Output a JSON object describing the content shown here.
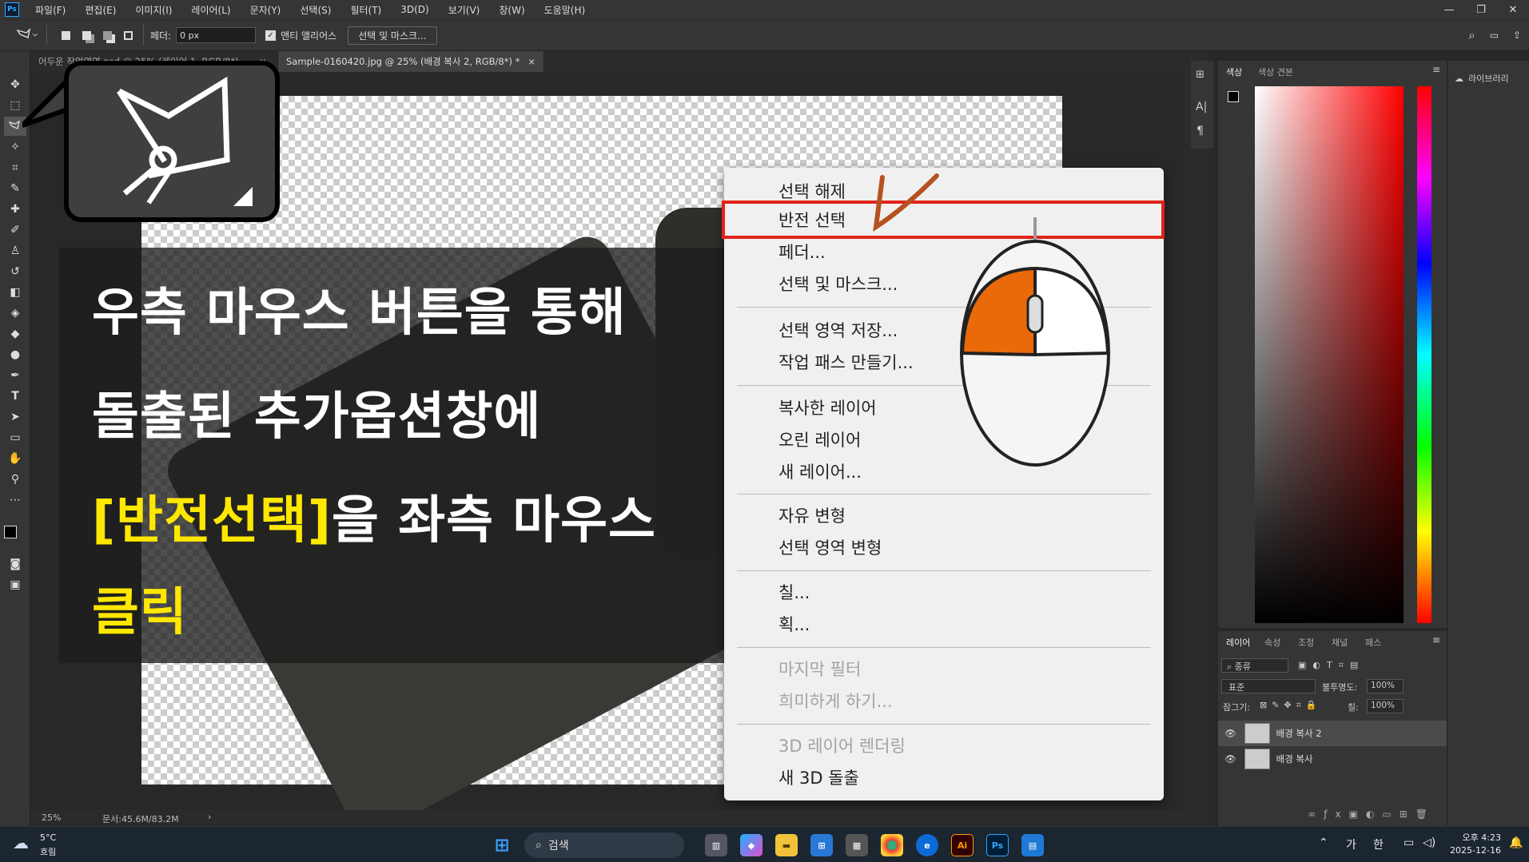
{
  "menubar": {
    "logo": "Ps",
    "items": [
      "파일(F)",
      "편집(E)",
      "이미지(I)",
      "레이어(L)",
      "문자(Y)",
      "선택(S)",
      "필터(T)",
      "3D(D)",
      "보기(V)",
      "창(W)",
      "도움말(H)"
    ]
  },
  "options": {
    "feather_label": "페더:",
    "feather_value": "0 px",
    "antialias_label": "앤티 앨리어스",
    "select_mask_button": "선택 및 마스크..."
  },
  "tabs": [
    {
      "label": "어두운 작업영역.psd @ 25% (레이어 1, RGB/8*)",
      "active": false
    },
    {
      "label": "Sample-0160420.jpg @ 25% (배경 복사 2, RGB/8*) *",
      "active": true
    }
  ],
  "overlay_text": {
    "line1": "우측 마우스 버튼을 통해",
    "line2": "돌출된 추가옵션창에",
    "line3_highlight": "[반전선택]",
    "line3_rest": "을 좌측 마우스",
    "line4": "클릭"
  },
  "context_menu": {
    "items": [
      {
        "label": "선택 해제",
        "enabled": true
      },
      {
        "label": "반전 선택",
        "enabled": true,
        "highlighted": true
      },
      {
        "label": "페더...",
        "enabled": true
      },
      {
        "label": "선택 및 마스크...",
        "enabled": true
      },
      {
        "label": "선택 영역 저장...",
        "enabled": true
      },
      {
        "label": "작업 패스 만들기...",
        "enabled": true
      },
      {
        "label": "복사한 레이어",
        "enabled": true
      },
      {
        "label": "오린 레이어",
        "enabled": true
      },
      {
        "label": "새 레이어...",
        "enabled": true
      },
      {
        "label": "자유 변형",
        "enabled": true
      },
      {
        "label": "선택 영역 변형",
        "enabled": true
      },
      {
        "label": "칠...",
        "enabled": true
      },
      {
        "label": "획...",
        "enabled": true
      },
      {
        "label": "마지막 필터",
        "enabled": false
      },
      {
        "label": "희미하게 하기...",
        "enabled": false
      },
      {
        "label": "3D 레이어 렌더링",
        "enabled": false
      },
      {
        "label": "새 3D 돌출",
        "enabled": true
      }
    ]
  },
  "color_panel": {
    "tabs": [
      "색상",
      "색상 견본"
    ]
  },
  "layers_panel": {
    "tabs": [
      "레이어",
      "속성",
      "조정",
      "채널",
      "패스"
    ],
    "filter": "종류",
    "blend_mode": "표준",
    "opacity_label": "불투명도:",
    "opacity_value": "100%",
    "lock_label": "잠그기:",
    "fill_label": "칠:",
    "fill_value": "100%",
    "layers": [
      "배경 복사 2",
      "배경 복사"
    ]
  },
  "library_panel": {
    "label": "라이브러리"
  },
  "status": {
    "zoom": "25%",
    "doc": "문서:45.6M/83.2M"
  },
  "taskbar": {
    "weather_temp": "5°C",
    "weather_desc": "흐림",
    "search_placeholder": "검색",
    "ime_1": "가",
    "ime_2": "한",
    "time": "오후 4:23",
    "date": "2025-12-16"
  },
  "colors": {
    "accent_highlight": "#e2231a",
    "text_yellow": "#ffe800",
    "mouse_orange": "#ea6a0a"
  }
}
